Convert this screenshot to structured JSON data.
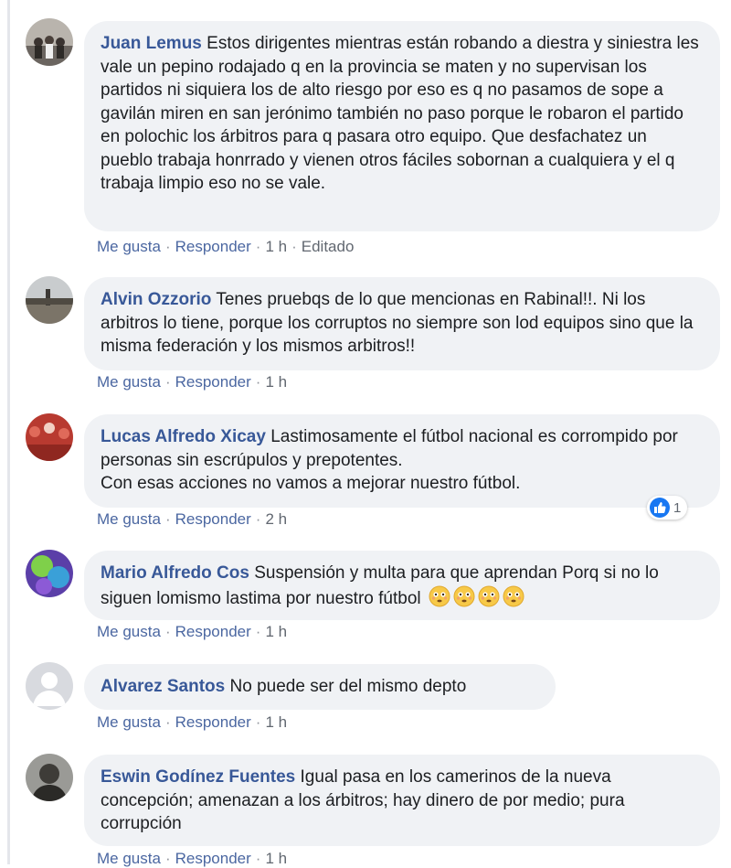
{
  "comments": [
    {
      "author": "Juan Lemus",
      "text": "Estos dirigentes mientras están robando a diestra y siniestra les vale un pepino rodajado q en la provincia se maten y no supervisan los partidos ni siquiera los de alto riesgo por eso es q no pasamos de sope a gavilán miren en san jerónimo también no paso porque le robaron el partido en polochic los árbitros para q pasara otro equipo. Que desfachatez un pueblo trabaja honrrado y vienen otros fáciles sobornan a cualquiera y el q trabaja limpio eso no se vale.",
      "like": "Me gusta",
      "reply": "Responder",
      "time": "1 h",
      "edited": "Editado"
    },
    {
      "author": "Alvin Ozzorio",
      "text": "Tenes pruebqs de lo que mencionas en Rabinal!!. Ni los arbitros lo tiene, porque los corruptos no siempre son lod equipos sino que la misma federación y los mismos arbitros!!",
      "like": "Me gusta",
      "reply": "Responder",
      "time": "1 h"
    },
    {
      "author": "Lucas Alfredo Xicay",
      "text": "Lastimosamente el fútbol nacional es corrompido por personas sin escrúpulos y prepotentes.",
      "text2": "Con esas acciones no vamos a mejorar nuestro fútbol.",
      "like": "Me gusta",
      "reply": "Responder",
      "time": "2 h",
      "reaction_count": "1",
      "reaction_icon": "thumbs-up-icon"
    },
    {
      "author": "Mario Alfredo Cos",
      "text": "Suspensión y multa para que aprendan Porq si no lo siguen lomismo lastima por nuestro fútbol",
      "emoji_icon": "flushed-face-icon",
      "emoji_count": 4,
      "like": "Me gusta",
      "reply": "Responder",
      "time": "1 h"
    },
    {
      "author": "Alvarez Santos",
      "text": "No puede ser del mismo depto",
      "like": "Me gusta",
      "reply": "Responder",
      "time": "1 h"
    },
    {
      "author": "Eswin Godínez Fuentes",
      "text": "Igual pasa en los camerinos de la nueva concepción; amenazan a los árbitros; hay dinero de por medio; pura corrupción",
      "like": "Me gusta",
      "reply": "Responder",
      "time": "1 h"
    }
  ],
  "colors": {
    "author": "#385898",
    "bubble": "#f0f2f5",
    "action_link": "#4b67a1",
    "like_blue": "#1877f2"
  }
}
